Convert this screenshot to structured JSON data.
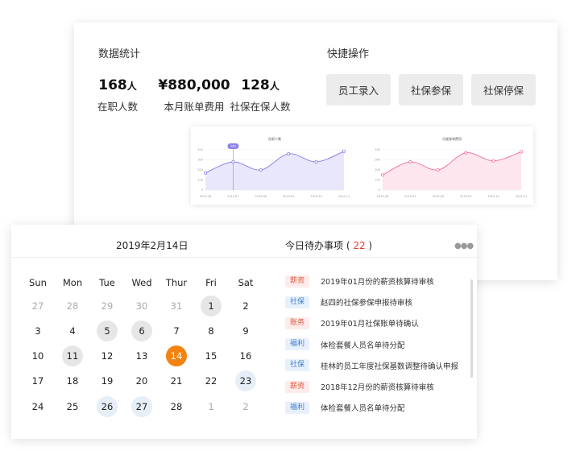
{
  "stats": {
    "title": "数据统计",
    "items": [
      {
        "value": "168",
        "unit": "人",
        "label": "在职人数"
      },
      {
        "value": "¥880,000",
        "unit": "",
        "label": "本月账单费用"
      },
      {
        "value": "128",
        "unit": "人",
        "label": "社保在保人数"
      }
    ]
  },
  "quick": {
    "title": "快捷操作",
    "buttons": [
      "员工录入",
      "社保参保",
      "社保停保"
    ]
  },
  "chart_data": [
    {
      "type": "line",
      "title": "在职人数",
      "x": [
        "2019.06",
        "2019.07",
        "2019.08",
        "2019.09",
        "2019.10",
        "2019.11"
      ],
      "values": [
        170,
        280,
        200,
        360,
        280,
        385
      ],
      "ylim": [
        0,
        400
      ],
      "yticks": [
        "400",
        "300",
        "200",
        "100",
        "0"
      ],
      "highlight_label": "280",
      "color": "#8c83e8",
      "fill": "#e4e1fa"
    },
    {
      "type": "line",
      "title": "月度账单费用",
      "x": [
        "2019.06",
        "2019.07",
        "2019.08",
        "2019.09",
        "2019.10",
        "2019.11"
      ],
      "values": [
        150,
        280,
        200,
        370,
        290,
        380
      ],
      "ylim": [
        0,
        400
      ],
      "yticks": [
        "400",
        "300",
        "200",
        "100",
        "0"
      ],
      "color": "#f07aa0",
      "fill": "#fde0ea"
    }
  ],
  "calendar": {
    "date": "2019年2月14日",
    "weekdays": [
      "Sun",
      "Mon",
      "Tue",
      "Wed",
      "Thur",
      "Fri",
      "Sat"
    ],
    "days": [
      [
        "27",
        "28",
        "29",
        "30",
        "31",
        "1",
        "2"
      ],
      [
        "3",
        "4",
        "5",
        "6",
        "7",
        "8",
        "9"
      ],
      [
        "10",
        "11",
        "12",
        "13",
        "14",
        "15",
        "16"
      ],
      [
        "17",
        "18",
        "19",
        "20",
        "21",
        "22",
        "23"
      ],
      [
        "24",
        "25",
        "26",
        "27",
        "28",
        "1",
        "2"
      ]
    ]
  },
  "todo": {
    "title": "今日待办事项",
    "count": "22",
    "items": [
      {
        "tag": "薪资",
        "text": "2019年01月份的薪资核算待审核",
        "color": "red"
      },
      {
        "tag": "社保",
        "text": "赵四的社保参保申报待审核",
        "color": "blue"
      },
      {
        "tag": "账务",
        "text": "2019年01月社保账单待确认",
        "color": "red"
      },
      {
        "tag": "福利",
        "text": "体检套餐人员名单待分配",
        "color": "blue"
      },
      {
        "tag": "社保",
        "text": "桂林的员工年度社保基数调整待确认申报",
        "color": "blue"
      },
      {
        "tag": "薪资",
        "text": "2018年12月份的薪资核算待审核",
        "color": "red"
      },
      {
        "tag": "福利",
        "text": "体检套餐人员名单待分配",
        "color": "blue"
      }
    ]
  }
}
